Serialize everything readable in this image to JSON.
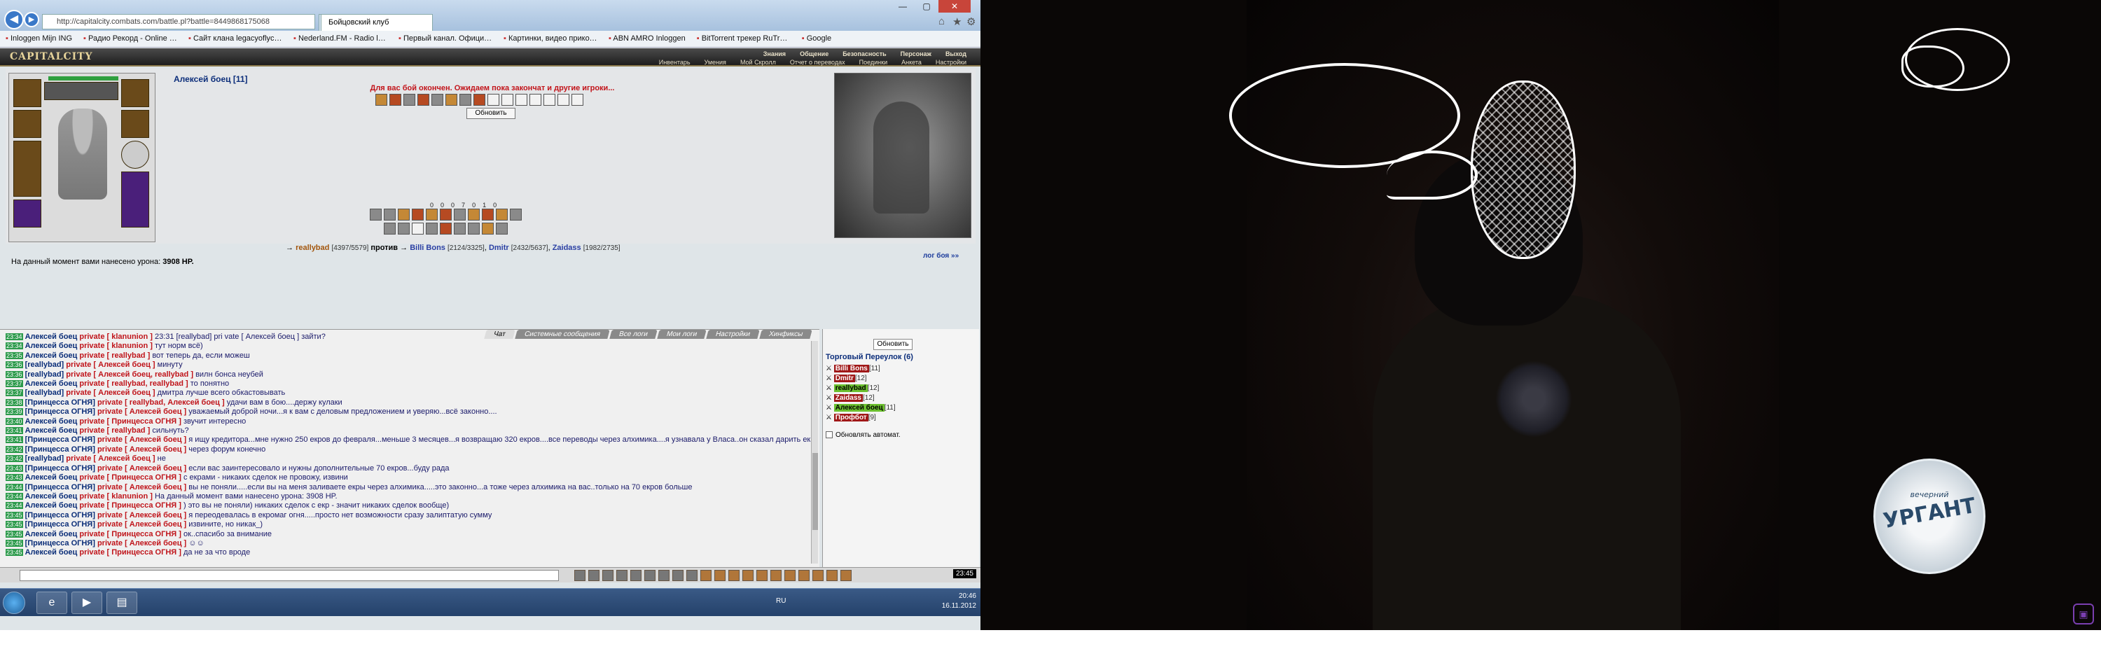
{
  "browser": {
    "url": "http://capitalcity.combats.com/battle.pl?battle=8449868175068",
    "tabs": [
      {
        "label": "http://capitalcity.combats.com/battle.pl?battle=8449868175068"
      },
      {
        "label": "Бойцовский клуб"
      }
    ],
    "controls": {
      "minimize": "—",
      "maximize": "▢",
      "close": "✕"
    },
    "bookmarks": [
      "Inloggen Mijn ING",
      "Радио Рекорд - Online Pl...",
      "Сайт клана legacyoflycaо...",
      "Nederland.FM - Radio luis...",
      "Первый канал. Официал...",
      "Картинки, видео прикол...",
      "ABN AMRO Inloggen",
      "BitTorrent трекер RuTrac...",
      "Google"
    ]
  },
  "game": {
    "logo": "CAPITALCITY",
    "menu_top": [
      "Знания",
      "Общение",
      "Безопасность",
      "Персонаж",
      "Выход"
    ],
    "menu_bottom": [
      "Инвентарь",
      "Умения",
      "Мой Скролл",
      "Отчет о переводах",
      "Поединки",
      "Анкета",
      "Настройки"
    ],
    "player_name": "Алексей боец [11]",
    "wait_message": "Для вас бой окончен. Ожидаем пока закончат и другие игроки...",
    "refresh_button": "Обновить",
    "stats": [
      "0",
      "0",
      "0",
      "7",
      "0",
      "1",
      "0"
    ],
    "fight": {
      "p1": "reallybad",
      "p1_hp": "[4397/5579]",
      "versus": "против",
      "p2": "Billi Bons",
      "p2_hp": "[2124/3325]",
      "p3": "Dmitr",
      "p3_hp": "[2432/5637]",
      "p4": "Zaidass",
      "p4_hp": "[1982/2735]"
    },
    "log_link": "лог боя »»",
    "damage_text": "На данный момент вами нанесено урона:",
    "damage_value": "3908 HP."
  },
  "chat": {
    "tabs": [
      "Чат",
      "Системные сообщения",
      "Все логи",
      "Мои логи",
      "Настройки",
      "Хинфиксы"
    ],
    "messages": [
      {
        "ts": "23:34",
        "name": "Алексей боец",
        "to": "private [ klanunion ]",
        "text": "23:31 [reallybad] pri vate [ Алексей боец ] зайти?"
      },
      {
        "ts": "23:34",
        "name": "Алексей боец",
        "to": "private [ klanunion ]",
        "text": "тут норм всё)"
      },
      {
        "ts": "23:35",
        "name": "Алексей боец",
        "to": "private [ reallybad ]",
        "text": "вот теперь да, если можеш"
      },
      {
        "ts": "23:36",
        "name": "[reallybad]",
        "to": "private [ Алексей боец ]",
        "text": "минуту"
      },
      {
        "ts": "23:36",
        "name": "[reallybad]",
        "to": "private [ Алексей боец, reallybad ]",
        "text": "вилн бонса неубей"
      },
      {
        "ts": "23:37",
        "name": "Алексей боец",
        "to": "private [ reallybad, reallybad ]",
        "text": "то понятно"
      },
      {
        "ts": "23:37",
        "name": "[reallybad]",
        "to": "private [ Алексей боец ]",
        "text": "дмитра лучше всего обкастовывать"
      },
      {
        "ts": "23:38",
        "name": "[Принцесса ОГНЯ]",
        "to": "private [ reallybad, Алексей боец ]",
        "text": "удачи вам в бою....держу кулаки"
      },
      {
        "ts": "23:39",
        "name": "[Принцесса ОГНЯ]",
        "to": "private [ Алексей боец ]",
        "text": "уважаемый доброй ночи...я к вам с деловым предложением и уверяю...всё законно...."
      },
      {
        "ts": "23:40",
        "name": "Алексей боец",
        "to": "private [ Принцесса ОГНЯ ]",
        "text": "звучит интересно"
      },
      {
        "ts": "23:41",
        "name": "Алексей боец",
        "to": "private [ reallybad ]",
        "text": "сильнуть?"
      },
      {
        "ts": "23:41",
        "name": "[Принцесса ОГНЯ]",
        "to": "private [ Алексей боец ]",
        "text": "я ищу кредитора...мне нужно 250 екров до февраля...меньше 3 месяцев...я возвращаю 320 екров....все переводы через алхимика....я узнавала у Власа..он сказал дарить екры законно"
      },
      {
        "ts": "23:42",
        "name": "[Принцесса ОГНЯ]",
        "to": "private [ Алексей боец ]",
        "text": "через форум конечно"
      },
      {
        "ts": "23:42",
        "name": "[reallybad]",
        "to": "private [ Алексей боец ]",
        "text": "не"
      },
      {
        "ts": "23:43",
        "name": "[Принцесса ОГНЯ]",
        "to": "private [ Алексей боец ]",
        "text": "если вас заинтересовало и нужны дополнительные 70 екров...буду рада"
      },
      {
        "ts": "23:43",
        "name": "Алексей боец",
        "to": "private [ Принцесса ОГНЯ ]",
        "text": "с екрами - никаких сделок не провожу, извини"
      },
      {
        "ts": "23:44",
        "name": "[Принцесса ОГНЯ]",
        "to": "private [ Алексей боец ]",
        "text": "вы не поняли.....если вы на меня заливаете екры через алхимика.....это законно...а тоже через алхимика на вас..только на 70 екров больше"
      },
      {
        "ts": "23:44",
        "name": "Алексей боец",
        "to": "private [ klanunion ]",
        "text": "На данный момент вами нанесено урона: 3908 HP."
      },
      {
        "ts": "23:44",
        "name": "Алексей боец",
        "to": "private [ Принцесса ОГНЯ ]",
        "text": ") это вы не поняли) никаких сделок с екр - значит никаких сделок вообще)"
      },
      {
        "ts": "23:45",
        "name": "[Принцесса ОГНЯ]",
        "to": "private [ Алексей боец ]",
        "text": "я переодевалась в екромаг огня.....просто нет возможности сразу залиптатую сумму"
      },
      {
        "ts": "23:45",
        "name": "[Принцесса ОГНЯ]",
        "to": "private [ Алексей боец ]",
        "text": "извините, но никак_)"
      },
      {
        "ts": "23:45",
        "name": "Алексей боец",
        "to": "private [ Принцесса ОГНЯ ]",
        "text": "ок..спасибо за внимание"
      },
      {
        "ts": "23:45",
        "name": "[Принцесса ОГНЯ]",
        "to": "private [ Алексей боец ]",
        "text": "☺☺"
      },
      {
        "ts": "23:45",
        "name": "Алексей боец",
        "to": "private [ Принцесса ОГНЯ ]",
        "text": "да не за что вроде"
      }
    ],
    "clock": "23:45"
  },
  "sidebar": {
    "refresh": "Обновить",
    "location": "Торговый Переулок (6)",
    "players": [
      {
        "nick": "Billi Bons",
        "lvl": "[11]",
        "green": false
      },
      {
        "nick": "Dmitr",
        "lvl": "[12]",
        "green": false
      },
      {
        "nick": "reallybad",
        "lvl": "[12]",
        "green": true
      },
      {
        "nick": "Zaidass",
        "lvl": "[12]",
        "green": false
      },
      {
        "nick": "Алексей боец",
        "lvl": "[11]",
        "green": true
      },
      {
        "nick": "Профбот",
        "lvl": "[9]",
        "green": false
      }
    ],
    "autorefresh": "Обновлять автомат."
  },
  "taskbar": {
    "lang": "RU",
    "time": "20:46",
    "date": "16.11.2012"
  },
  "video": {
    "badge_line1": "вечерний",
    "badge_line2": "УРГАНТ"
  }
}
